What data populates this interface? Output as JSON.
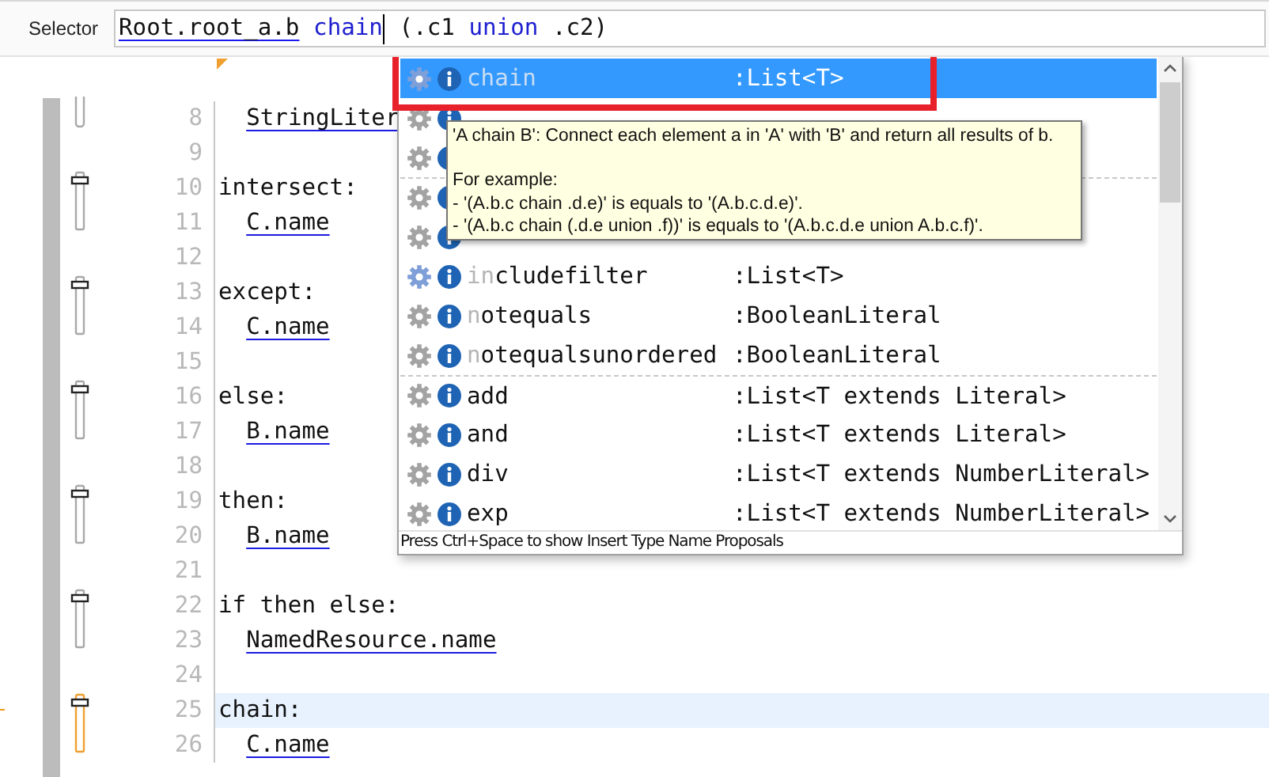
{
  "selector": {
    "label": "Selector",
    "tokens": [
      {
        "text": "Root.root_a.b",
        "kind": "path"
      },
      {
        "text": "chain",
        "kind": "keyword"
      },
      {
        "kind": "caret"
      },
      {
        "text": "(.c1",
        "kind": "plain"
      },
      {
        "text": "union",
        "kind": "keyword"
      },
      {
        "text": ".c2)",
        "kind": "plain"
      }
    ]
  },
  "editor": {
    "lines": [
      {
        "number": "8",
        "text": "StringLiter",
        "kind": "reference",
        "fold_tail": true
      },
      {
        "number": "9"
      },
      {
        "number": "10",
        "text": "intersect:",
        "kind": "label",
        "fold_start": true
      },
      {
        "number": "11",
        "text": "C.name",
        "kind": "reference"
      },
      {
        "number": "12"
      },
      {
        "number": "13",
        "text": "except:",
        "kind": "label",
        "fold_start": true
      },
      {
        "number": "14",
        "text": "C.name",
        "kind": "reference"
      },
      {
        "number": "15"
      },
      {
        "number": "16",
        "text": "else:",
        "kind": "label",
        "fold_start": true
      },
      {
        "number": "17",
        "text": "B.name",
        "kind": "reference"
      },
      {
        "number": "18"
      },
      {
        "number": "19",
        "text": "then:",
        "kind": "label",
        "fold_start": true
      },
      {
        "number": "20",
        "text": "B.name",
        "kind": "reference"
      },
      {
        "number": "21"
      },
      {
        "number": "22",
        "text": "if then else:",
        "kind": "label",
        "fold_start": true
      },
      {
        "number": "23",
        "text": "NamedResource.name",
        "kind": "reference"
      },
      {
        "number": "24"
      },
      {
        "number": "25",
        "text": "chain:",
        "kind": "label",
        "fold_start": true,
        "current": true
      },
      {
        "number": "26",
        "text": "C.name",
        "kind": "reference"
      }
    ]
  },
  "completion": {
    "items": [
      {
        "prefix": "chain",
        "type": ":List<T>",
        "selected": true,
        "blue_gear": true
      },
      {
        "selected": false,
        "blue_gear": false
      },
      {
        "selected": false,
        "blue_gear": false
      },
      {
        "selected": false,
        "group_start": true,
        "blue_gear": false
      },
      {
        "selected": false,
        "blue_gear": false
      },
      {
        "prefix": "in",
        "rest": "cludefilter",
        "type": ":List<T>",
        "selected": false,
        "blue_gear": true
      },
      {
        "prefix": "n",
        "rest": "otequals",
        "type": ":BooleanLiteral",
        "selected": false,
        "blue_gear": false
      },
      {
        "prefix": "n",
        "rest": "otequalsunordered",
        "type": ":BooleanLiteral",
        "selected": false,
        "blue_gear": false
      },
      {
        "rest": "add",
        "type": ":List<T extends Literal>",
        "selected": false,
        "group_start": true,
        "blue_gear": false
      },
      {
        "rest": "and",
        "type": ":List<T extends Literal>",
        "selected": false,
        "blue_gear": false
      },
      {
        "rest": "div",
        "type": ":List<T extends NumberLiteral>",
        "selected": false,
        "blue_gear": false
      },
      {
        "rest": "exp",
        "type": ":List<T extends NumberLiteral>",
        "selected": false,
        "blue_gear": false
      }
    ],
    "status": "Press Ctrl+Space to show Insert Type Name Proposals",
    "tooltip": {
      "summary": "'A chain B': Connect each element a in 'A' with 'B' and return all results of b.",
      "example_title": "For example:",
      "examples": [
        "- '(A.b.c chain .d.e)' is equals to '(A.b.c.d.e)'.",
        "- '(A.b.c chain (.d.e union .f))' is equals to '(A.b.c.d.e union A.b.c.f)'."
      ]
    }
  }
}
